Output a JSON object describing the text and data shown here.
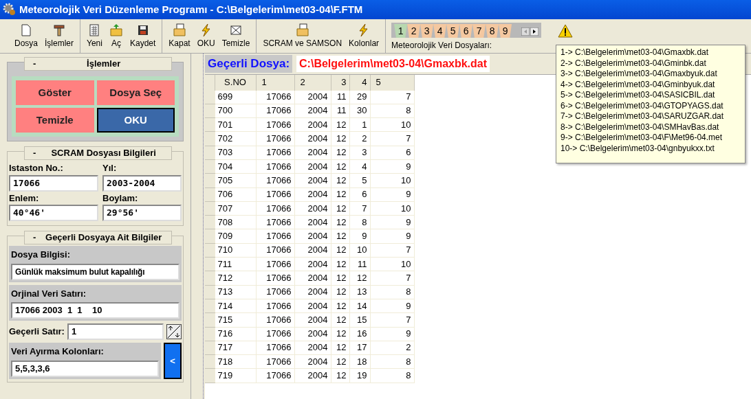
{
  "window": {
    "title": "Meteorolojik Veri Düzenleme Programı - C:\\Belgelerim\\met03-04\\F.FTM"
  },
  "toolbar": {
    "groups": [
      [
        "Dosya",
        "İşlemler"
      ],
      [
        "Yeni",
        "Aç",
        "Kaydet"
      ],
      [
        "Kapat",
        "OKU",
        "Temizle"
      ],
      [
        "SCRAM ve SAMSON",
        "Kolonlar"
      ]
    ]
  },
  "file_tabs": {
    "tabs": [
      {
        "label": "1",
        "selected": true
      },
      {
        "label": "2",
        "selected": false
      },
      {
        "label": "3",
        "selected": false
      },
      {
        "label": "4",
        "selected": false
      },
      {
        "label": "5",
        "selected": false
      },
      {
        "label": "6",
        "selected": false
      },
      {
        "label": "7",
        "selected": false
      },
      {
        "label": "8",
        "selected": false
      },
      {
        "label": "9",
        "selected": false
      }
    ],
    "caption": "Meteorolojik Veri Dosyaları:"
  },
  "tooltip": [
    "1-> C:\\Belgelerim\\met03-04\\Gmaxbk.dat",
    "2-> C:\\Belgelerim\\met03-04\\Gminbk.dat",
    "3-> C:\\Belgelerim\\met03-04\\Gmaxbyuk.dat",
    "4-> C:\\Belgelerim\\met03-04\\Gminbyuk.dat",
    "5-> C:\\Belgelerim\\met03-04\\SASICBIL.dat",
    "6-> C:\\Belgelerim\\met03-04\\GTOPYAGS.dat",
    "7-> C:\\Belgelerim\\met03-04\\SARUZGAR.dat",
    "8-> C:\\Belgelerim\\met03-04\\SMHavBas.dat",
    "9-> C:\\Belgelerim\\met03-04\\F\\Met96-04.met",
    "10-> C:\\Belgelerim\\met03-04\\gnbyukxx.txt"
  ],
  "operations": {
    "collapse": "-",
    "title": "İşlemler",
    "buttons": [
      {
        "label": "Göster",
        "kind": "plain"
      },
      {
        "label": "Dosya Seç",
        "kind": "plain"
      },
      {
        "label": "Temizle",
        "kind": "plain"
      },
      {
        "label": "OKU",
        "kind": "default"
      }
    ]
  },
  "scram": {
    "collapse": "-",
    "title": "SCRAM Dosyası Bilgileri",
    "fields": [
      {
        "label": "Istaston No.:",
        "value": "17066"
      },
      {
        "label": "Yıl:",
        "value": "2003-2004"
      },
      {
        "label": "Enlem:",
        "value": "40°46'"
      },
      {
        "label": "Boylam:",
        "value": "29°56'"
      }
    ]
  },
  "current_info": {
    "collapse": "-",
    "title": "Geçerli Dosyaya Ait Bilgiler",
    "file_info_label": "Dosya Bilgisi:",
    "file_info": "Günlük maksimum bulut kapalılığı",
    "original_label": "Orjinal Veri Satırı:",
    "original": "17066 2003  1  1    10",
    "row_label": "Geçerli Satır:",
    "row": "1",
    "columns_label": "Veri Ayırma Kolonları:",
    "columns": "5,5,3,3,6",
    "apply": "<"
  },
  "current_file": {
    "label": "Geçerli Dosya:",
    "path": "C:\\Belgelerim\\met03-04\\Gmaxbk.dat"
  },
  "table": {
    "columns": [
      "S.NO",
      "1",
      "2",
      "3",
      "4",
      "5"
    ],
    "rows": [
      [
        "699",
        "17066",
        "2004",
        "11",
        "29",
        "7"
      ],
      [
        "700",
        "17066",
        "2004",
        "11",
        "30",
        "8"
      ],
      [
        "701",
        "17066",
        "2004",
        "12",
        "1",
        "10"
      ],
      [
        "702",
        "17066",
        "2004",
        "12",
        "2",
        "7"
      ],
      [
        "703",
        "17066",
        "2004",
        "12",
        "3",
        "6"
      ],
      [
        "704",
        "17066",
        "2004",
        "12",
        "4",
        "9"
      ],
      [
        "705",
        "17066",
        "2004",
        "12",
        "5",
        "10"
      ],
      [
        "706",
        "17066",
        "2004",
        "12",
        "6",
        "9"
      ],
      [
        "707",
        "17066",
        "2004",
        "12",
        "7",
        "10"
      ],
      [
        "708",
        "17066",
        "2004",
        "12",
        "8",
        "9"
      ],
      [
        "709",
        "17066",
        "2004",
        "12",
        "9",
        "9"
      ],
      [
        "710",
        "17066",
        "2004",
        "12",
        "10",
        "7"
      ],
      [
        "711",
        "17066",
        "2004",
        "12",
        "11",
        "10"
      ],
      [
        "712",
        "17066",
        "2004",
        "12",
        "12",
        "7"
      ],
      [
        "713",
        "17066",
        "2004",
        "12",
        "13",
        "8"
      ],
      [
        "714",
        "17066",
        "2004",
        "12",
        "14",
        "9"
      ],
      [
        "715",
        "17066",
        "2004",
        "12",
        "15",
        "7"
      ],
      [
        "716",
        "17066",
        "2004",
        "12",
        "16",
        "9"
      ],
      [
        "717",
        "17066",
        "2004",
        "12",
        "17",
        "2"
      ],
      [
        "718",
        "17066",
        "2004",
        "12",
        "18",
        "8"
      ],
      [
        "719",
        "17066",
        "2004",
        "12",
        "19",
        "8"
      ]
    ]
  }
}
